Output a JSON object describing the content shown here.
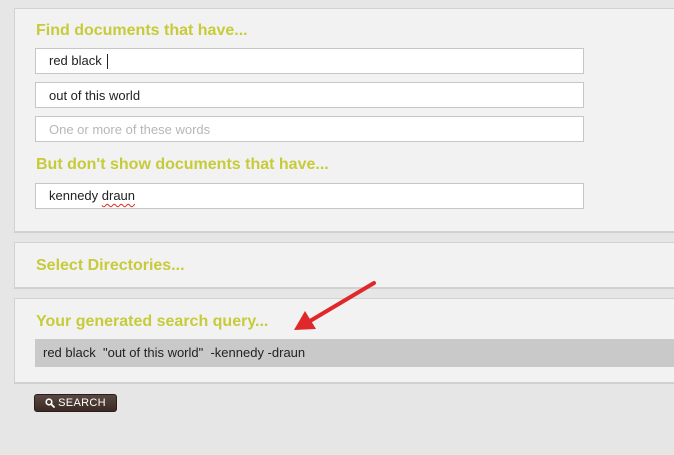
{
  "find_section": {
    "heading": "Find documents that have...",
    "all_words_value": "red black ",
    "exact_phrase_value": "out of this world",
    "any_words_placeholder": "One or more of these words",
    "any_words_value": ""
  },
  "exclude_section": {
    "heading": "But don't show documents that have...",
    "excluded_first_word": "kennedy ",
    "excluded_misspelled_word": "draun"
  },
  "directories_section": {
    "heading": "Select Directories..."
  },
  "query_section": {
    "heading": "Your generated search query...",
    "query": "red black  \"out of this world\"  -kennedy -draun"
  },
  "search_button": {
    "label": "SEARCH",
    "icon": "magnifier-icon"
  },
  "colors": {
    "heading": "#c7cb3a",
    "annotation_arrow": "#e0282a",
    "button": "#3f2e29"
  }
}
